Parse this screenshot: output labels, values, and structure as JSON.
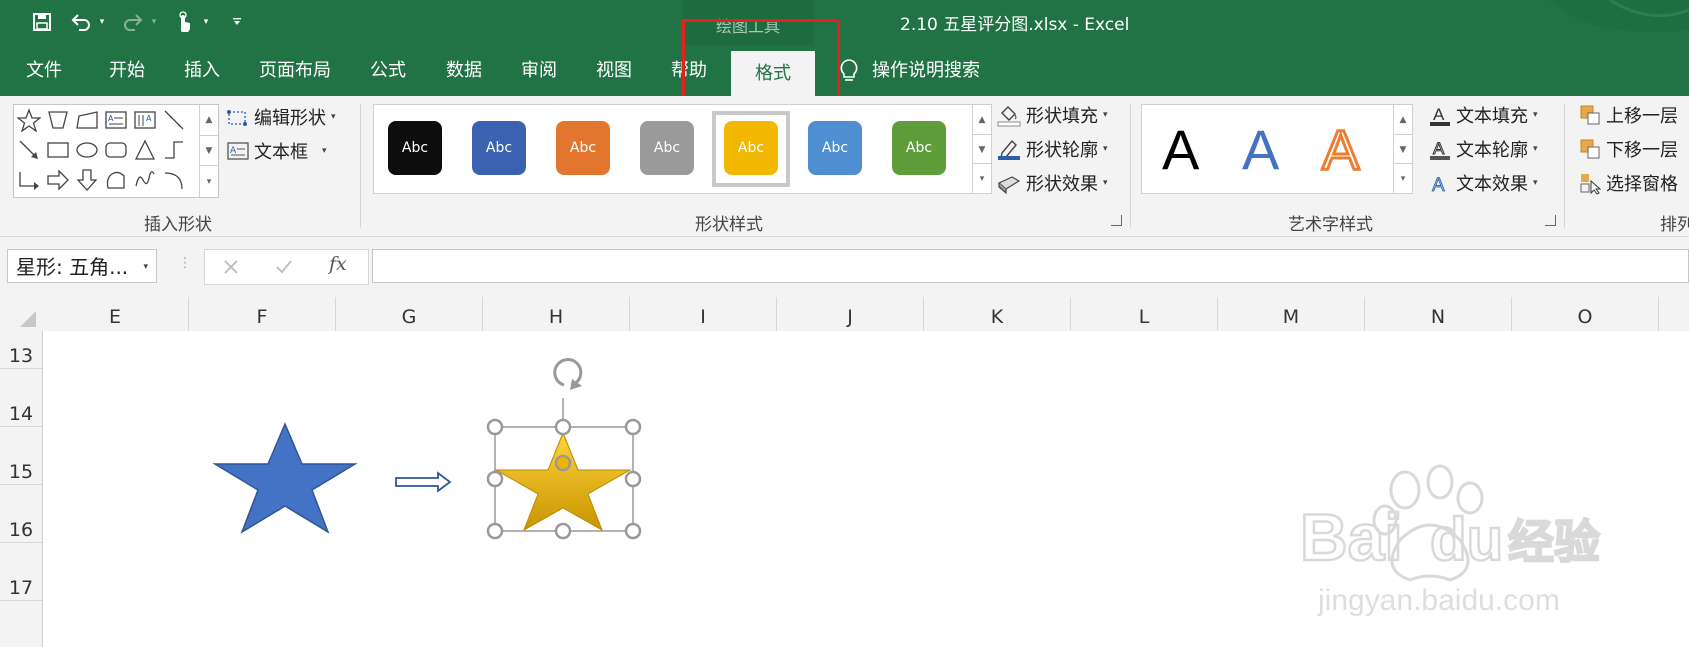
{
  "window": {
    "doc_title": "2.10 五星评分图.xlsx  -  Excel",
    "context_group": "绘图工具"
  },
  "tabs": [
    "文件",
    "开始",
    "插入",
    "页面布局",
    "公式",
    "数据",
    "审阅",
    "视图",
    "帮助",
    "格式"
  ],
  "active_tab": "格式",
  "tell_me": "操作说明搜索",
  "ribbon": {
    "insert_shapes": {
      "label": "插入形状",
      "edit_shape": "编辑形状",
      "text_box": "文本框"
    },
    "shape_styles": {
      "label": "形状样式",
      "preview_text": "Abc",
      "swatches": [
        {
          "color": "#0d0d0d"
        },
        {
          "color": "#3a62b0"
        },
        {
          "color": "#e3762f"
        },
        {
          "color": "#9a9a9a"
        },
        {
          "color": "#f2b800",
          "selected": true
        },
        {
          "color": "#4f8fd1"
        },
        {
          "color": "#5f9d3a"
        }
      ],
      "fill": "形状填充",
      "outline": "形状轮廓",
      "effects": "形状效果"
    },
    "wordart": {
      "label": "艺术字样式",
      "sample": "A",
      "fill": "文本填充",
      "outline": "文本轮廓",
      "effects": "文本效果"
    },
    "arrange": {
      "label": "排列",
      "bring_forward": "上移一层",
      "send_backward": "下移一层",
      "selection_pane": "选择窗格"
    }
  },
  "formula_bar": {
    "name_box": "星形: 五角...",
    "fx": "fx",
    "value": ""
  },
  "columns": [
    "E",
    "F",
    "G",
    "H",
    "I",
    "J",
    "K",
    "L",
    "M",
    "N",
    "O"
  ],
  "rows": [
    "13",
    "14",
    "15",
    "16",
    "17"
  ],
  "shapes": {
    "star_left_color": "#4472c4",
    "star_right_color": "#f2b800"
  },
  "watermark": {
    "logo": "Baidu经验",
    "url": "jingyan.baidu.com"
  },
  "colors": {
    "excel_green": "#217346",
    "highlight_red": "#e62020"
  }
}
